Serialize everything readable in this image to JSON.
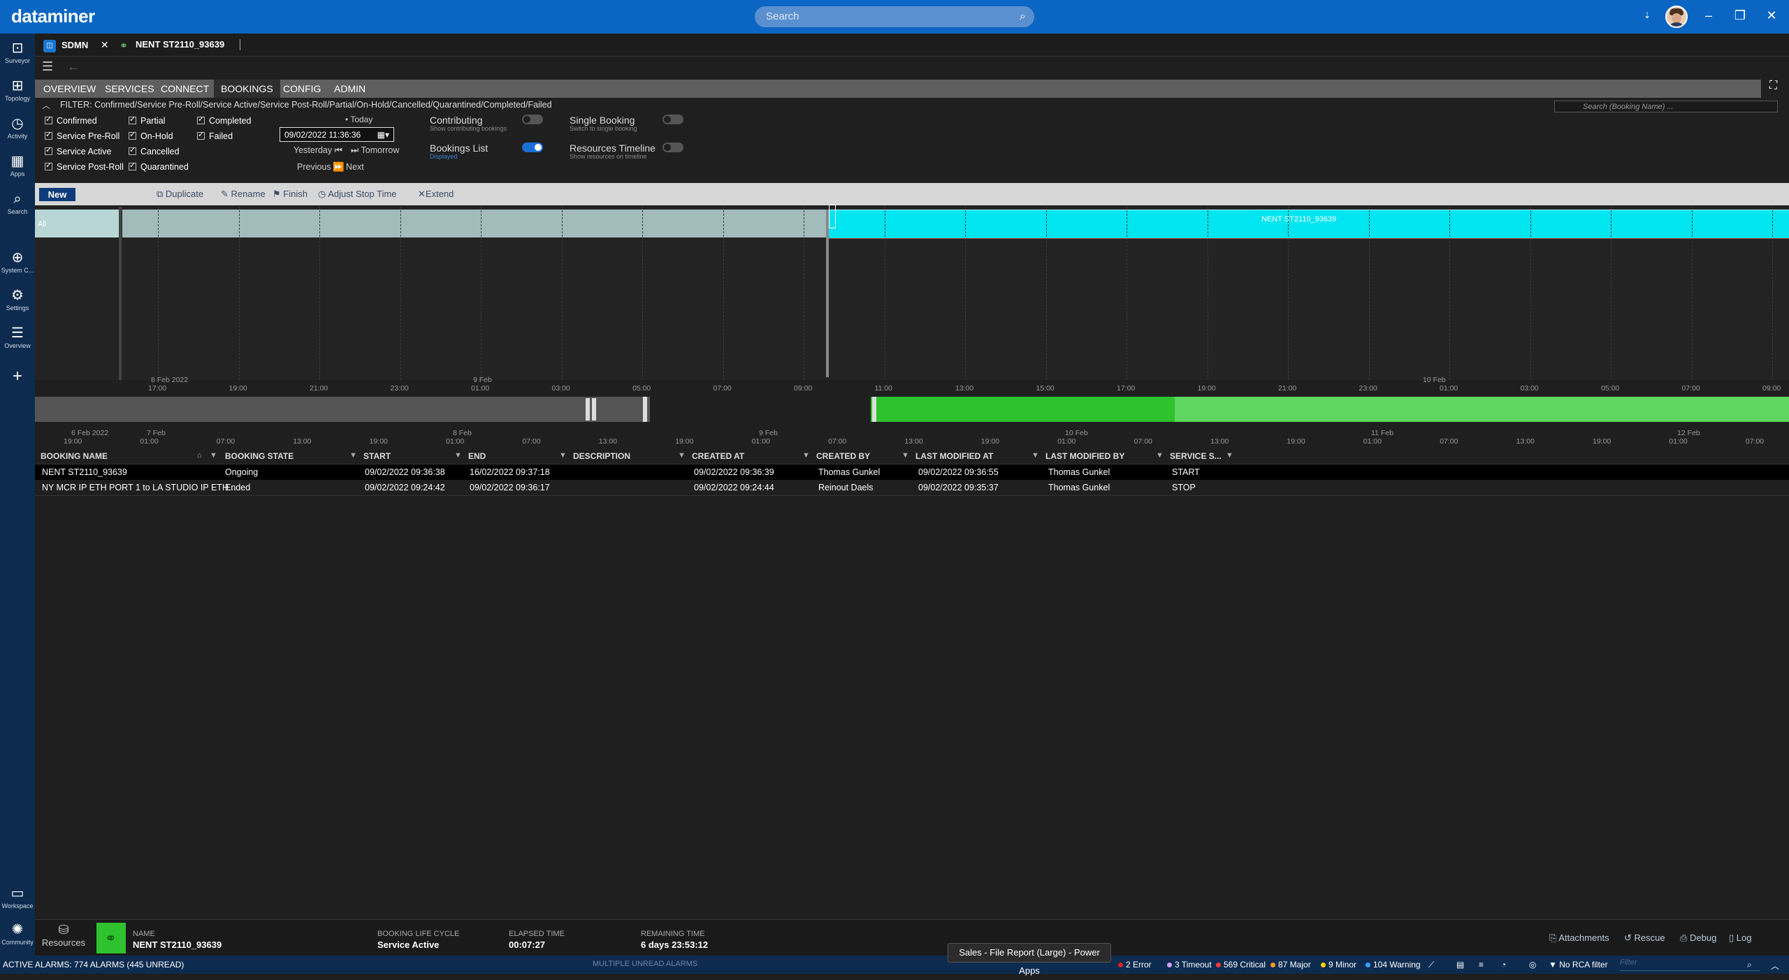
{
  "app": {
    "brand": "dataminer",
    "search_placeholder": "Search"
  },
  "nav": [
    {
      "label": "Surveyor"
    },
    {
      "label": "Topology"
    },
    {
      "label": "Activity"
    },
    {
      "label": "Apps"
    },
    {
      "label": "Search"
    },
    {
      "label": "System C..."
    },
    {
      "label": "Settings"
    },
    {
      "label": "Overview"
    },
    {
      "label": "Workspace"
    },
    {
      "label": "Community"
    }
  ],
  "tabs": [
    {
      "label": "SDMN"
    },
    {
      "label": "NENT ST2110_93639"
    }
  ],
  "module_tabs": [
    "OVERVIEW",
    "SERVICES",
    "CONNECT",
    "BOOKINGS",
    "CONFIG",
    "ADMIN"
  ],
  "filter": {
    "text": "FILTER: Confirmed/Service Pre-Roll/Service Active/Service Post-Roll/Partial/On-Hold/Cancelled/Quarantined/Completed/Failed",
    "search_placeholder": "Search (Booking Name) ...",
    "checkboxes": [
      "Confirmed",
      "Service Pre-Roll",
      "Service Active",
      "Service Post-Roll",
      "Partial",
      "On-Hold",
      "Cancelled",
      "Quarantined",
      "Completed",
      "Failed"
    ],
    "date_value": "09/02/2022 11:36:36",
    "today": "Today",
    "yesterday": "Yesterday",
    "tomorrow": "Tomorrow",
    "previous": "Previous",
    "next": "Next",
    "contributing": "Contributing",
    "contributing_sub": "Show contributing bookings",
    "bookings_list": "Bookings List",
    "bookings_list_sub": "Displayed",
    "single_booking": "Single Booking",
    "single_booking_sub": "Switch to single booking",
    "resources_timeline": "Resources Timeline",
    "resources_timeline_sub": "Show resources on timeline"
  },
  "actions": {
    "new": "New",
    "duplicate": "Duplicate",
    "rename": "Rename",
    "finish": "Finish",
    "adjust": "Adjust Stop Time",
    "extend": "Extend"
  },
  "timeline": {
    "row_label": "All",
    "booking_bar_label": "NENT ST2110_93639",
    "ticks": [
      "17:00",
      "19:00",
      "21:00",
      "23:00",
      "01:00",
      "03:00",
      "05:00",
      "07:00",
      "09:00",
      "11:00",
      "13:00",
      "15:00",
      "17:00",
      "19:00",
      "21:00",
      "23:00",
      "01:00",
      "03:00",
      "05:00",
      "07:00",
      "09:00"
    ],
    "day_labels": [
      "8 Feb 2022",
      "9 Feb",
      "10 Feb"
    ],
    "nav_ticks": [
      "19:00",
      "01:00",
      "07:00",
      "13:00",
      "19:00",
      "01:00",
      "07:00",
      "13:00",
      "19:00",
      "01:00",
      "07:00",
      "13:00",
      "19:00",
      "01:00",
      "07:00",
      "13:00",
      "19:00",
      "01:00",
      "07:00",
      "13:00",
      "19:00",
      "01:00",
      "07:00"
    ],
    "nav_days": [
      "6 Feb 2022",
      "7 Feb",
      "8 Feb",
      "9 Feb",
      "10 Feb",
      "11 Feb",
      "12 Feb"
    ]
  },
  "table": {
    "columns": [
      "BOOKING NAME",
      "BOOKING STATE",
      "START",
      "END",
      "DESCRIPTION",
      "CREATED AT",
      "CREATED BY",
      "LAST MODIFIED AT",
      "LAST MODIFIED BY",
      "SERVICE S..."
    ],
    "rows": [
      [
        "NENT ST2110_93639",
        "Ongoing",
        "09/02/2022 09:36:38",
        "16/02/2022 09:37:18",
        "",
        "09/02/2022 09:36:39",
        "Thomas Gunkel",
        "09/02/2022 09:36:55",
        "Thomas Gunkel",
        "START"
      ],
      [
        "NY MCR IP ETH PORT 1 to LA STUDIO IP ETH...",
        "Ended",
        "09/02/2022 09:24:42",
        "09/02/2022 09:36:17",
        "",
        "09/02/2022 09:24:44",
        "Reinout Daels",
        "09/02/2022 09:35:37",
        "Thomas Gunkel",
        "STOP"
      ]
    ]
  },
  "footer": {
    "resources": "Resources",
    "name_key": "NAME",
    "name_val": "NENT ST2110_93639",
    "lifecycle_key": "BOOKING LIFE CYCLE",
    "lifecycle_val": "Service Active",
    "elapsed_key": "ELAPSED TIME",
    "elapsed_val": "00:07:27",
    "remaining_key": "REMAINING TIME",
    "remaining_val": "6 days 23:53:12",
    "attachments": "Attachments",
    "rescue": "Rescue",
    "debug": "Debug",
    "log": "Log"
  },
  "status": {
    "alarms": "ACTIVE ALARMS: 774 ALARMS (445 UNREAD)",
    "multiple": "MULTIPLE UNREAD ALARMS",
    "error": "2 Error",
    "timeout": "3 Timeout",
    "critical": "569 Critical",
    "major": "87 Major",
    "minor": "9 Minor",
    "warning": "104 Warning",
    "rca": "No RCA filter",
    "filter_placeholder": "Filter",
    "tooltip": "Sales - File Report (Large) - Power Apps"
  },
  "colors": {
    "brand_blue": "#0a66c2",
    "booking_cyan": "#00e5f0",
    "active_green": "#2ec22e",
    "nav_navy": "#0d2b4e"
  }
}
